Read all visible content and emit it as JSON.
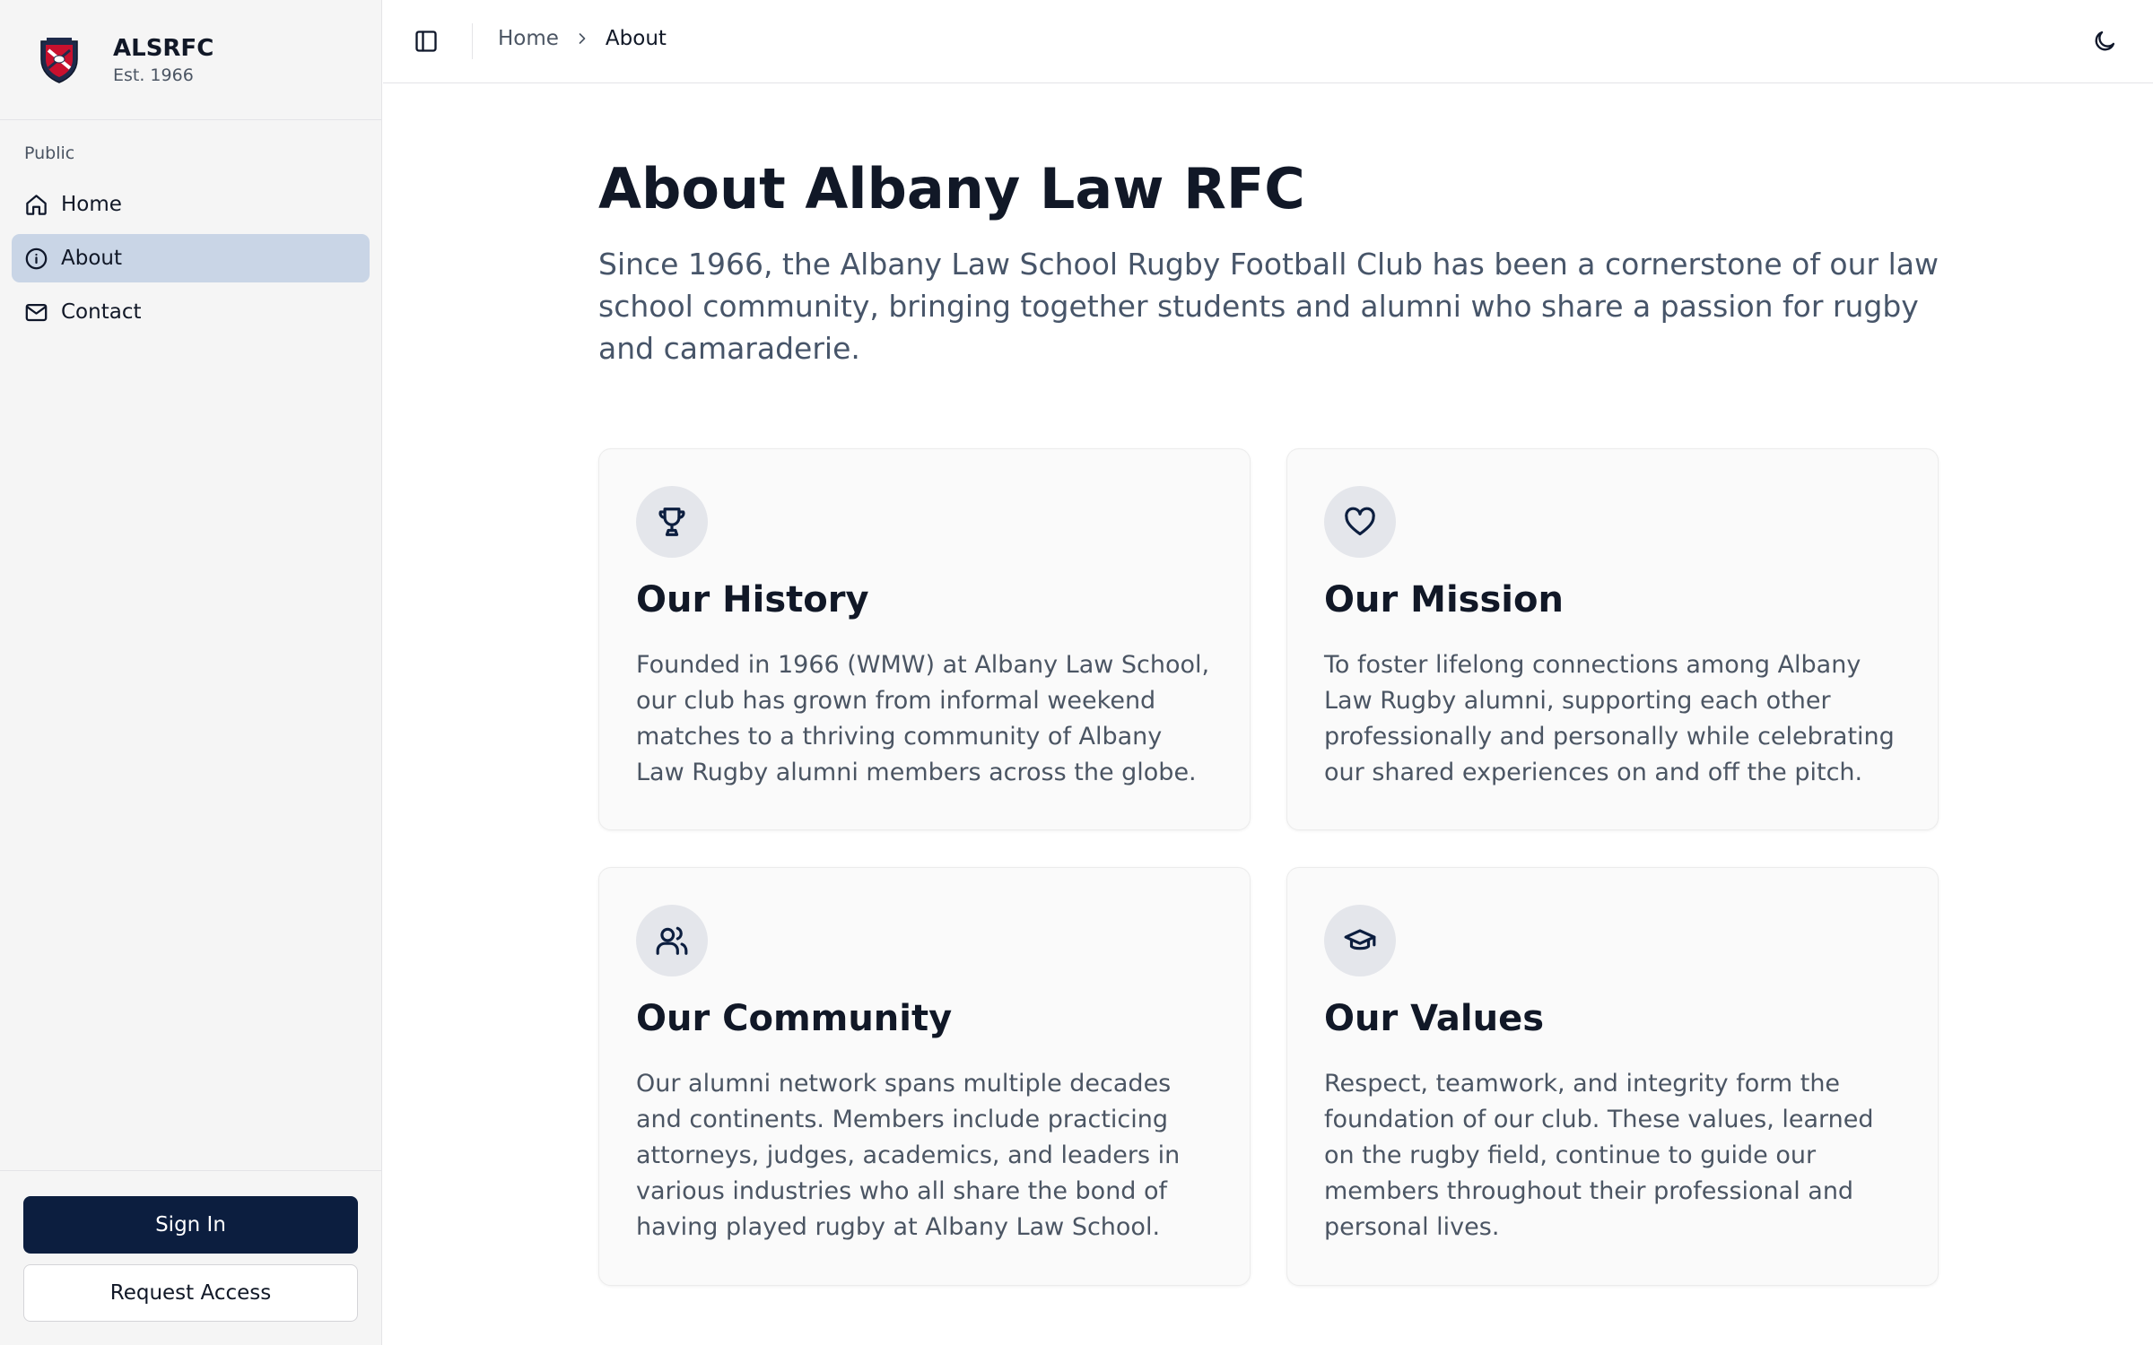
{
  "brand": {
    "name": "ALSRFC",
    "subtitle": "Est. 1966"
  },
  "sidebar": {
    "group_label": "Public",
    "items": [
      {
        "label": "Home",
        "icon": "home-icon"
      },
      {
        "label": "About",
        "icon": "info-icon",
        "active": true
      },
      {
        "label": "Contact",
        "icon": "mail-icon"
      }
    ],
    "sign_in_label": "Sign In",
    "request_access_label": "Request Access"
  },
  "header": {
    "breadcrumb": {
      "home": "Home",
      "current": "About"
    }
  },
  "main": {
    "title": "About Albany Law RFC",
    "intro": "Since 1966, the Albany Law School Rugby Football Club has been a cornerstone of our law school community, bringing together students and alumni who share a passion for rugby and camaraderie.",
    "cards": [
      {
        "icon": "trophy-icon",
        "title": "Our History",
        "text": "Founded in 1966 (WMW) at Albany Law School, our club has grown from informal weekend matches to a thriving community of Albany Law Rugby alumni members across the globe."
      },
      {
        "icon": "heart-icon",
        "title": "Our Mission",
        "text": "To foster lifelong connections among Albany Law Rugby alumni, supporting each other professionally and personally while celebrating our shared experiences on and off the pitch."
      },
      {
        "icon": "users-icon",
        "title": "Our Community",
        "text": "Our alumni network spans multiple decades and continents. Members include practicing attorneys, judges, academics, and leaders in various industries who all share the bond of having played rugby at Albany Law School."
      },
      {
        "icon": "graduation-cap-icon",
        "title": "Our Values",
        "text": "Respect, teamwork, and integrity form the foundation of our club. These values, learned on the rugby field, continue to guide our members throughout their professional and personal lives."
      }
    ]
  },
  "colors": {
    "primary": "#0c1e3f",
    "active_nav": "#c9d5e6",
    "sidebar_bg": "#f5f5f5",
    "crest_red": "#c8102e"
  }
}
